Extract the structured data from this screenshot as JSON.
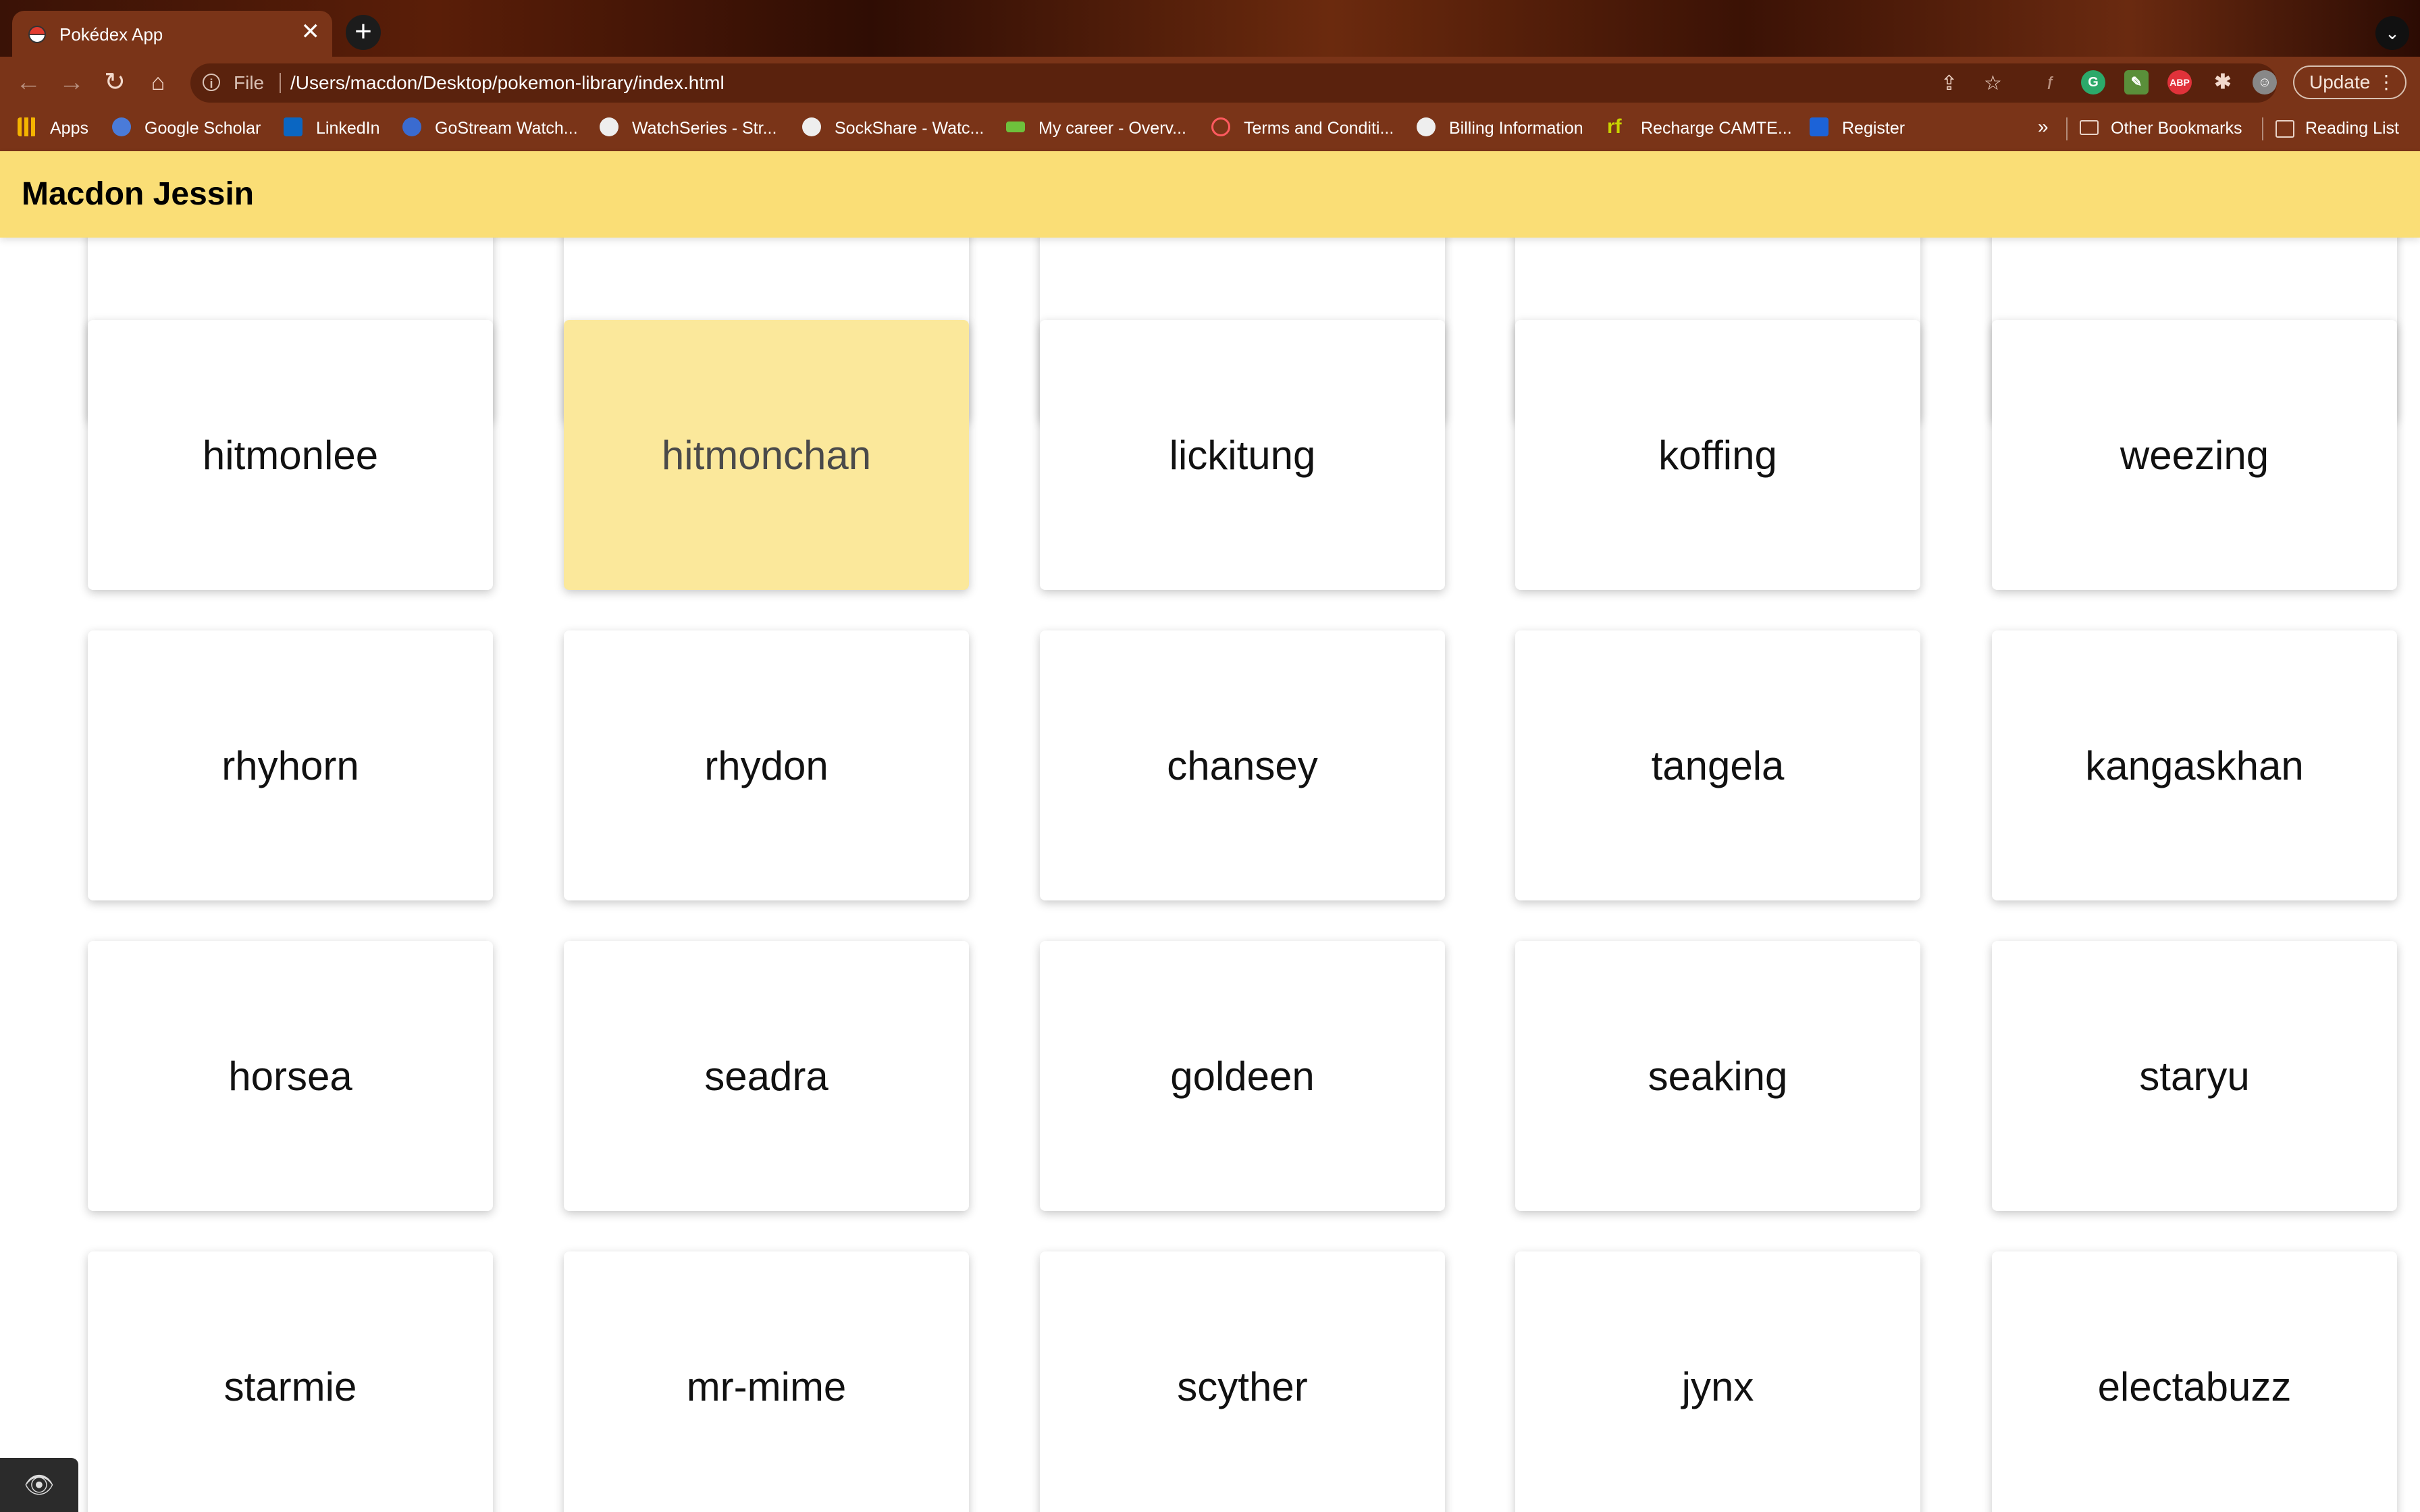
{
  "browser": {
    "tab_title": "Pokédex App",
    "tab_close": "✕",
    "new_tab": "+",
    "tab_search": "⌄",
    "address_scheme": "File",
    "address_url": "/Users/macdon/Desktop/pokemon-library/index.html",
    "update_label": "Update",
    "menu_dots": "⋮",
    "bookmarks": [
      {
        "label": "Apps",
        "icon": "apps-grid-icon"
      },
      {
        "label": "Google Scholar",
        "icon": "scholar-icon"
      },
      {
        "label": "LinkedIn",
        "icon": "linkedin-icon"
      },
      {
        "label": "GoStream Watch...",
        "icon": "gostream-icon"
      },
      {
        "label": "WatchSeries - Str...",
        "icon": "globe-icon"
      },
      {
        "label": "SockShare - Watc...",
        "icon": "globe-icon"
      },
      {
        "label": "My career - Overv...",
        "icon": "career-icon"
      },
      {
        "label": "Terms and Conditi...",
        "icon": "airbnb-icon"
      },
      {
        "label": "Billing Information",
        "icon": "globe-icon"
      },
      {
        "label": "Recharge CAMTE...",
        "icon": "rf-icon"
      },
      {
        "label": "Register",
        "icon": "register-icon"
      }
    ],
    "more_bookmarks": "»",
    "other_bookmarks": "Other Bookmarks",
    "reading_list": "Reading List"
  },
  "app": {
    "title": "Macdon Jessin"
  },
  "pokemon": [
    [
      "hitmonlee",
      "hitmonchan",
      "lickitung",
      "koffing",
      "weezing"
    ],
    [
      "rhyhorn",
      "rhydon",
      "chansey",
      "tangela",
      "kangaskhan"
    ],
    [
      "horsea",
      "seadra",
      "goldeen",
      "seaking",
      "staryu"
    ],
    [
      "starmie",
      "mr-mime",
      "scyther",
      "jynx",
      "electabuzz"
    ]
  ],
  "hovered_card": "hitmonchan",
  "colors": {
    "header_bg": "#fade76",
    "hover_card_bg": "#fbe89b",
    "chrome_bg": "#7a3418"
  }
}
